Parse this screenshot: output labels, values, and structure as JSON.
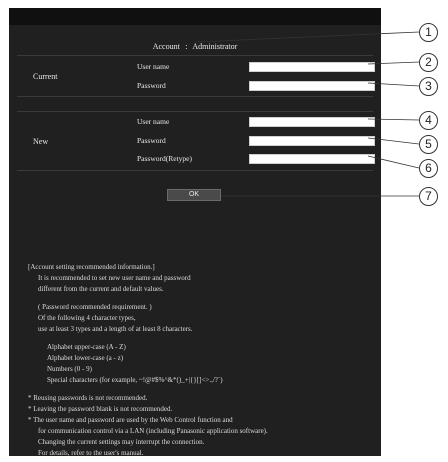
{
  "account": {
    "label": "Account",
    "separator": ":",
    "value": "Administrator"
  },
  "current": {
    "group_label": "Current",
    "user_name_label": "User name",
    "password_label": "Password",
    "user_name_value": "",
    "password_value": ""
  },
  "new": {
    "group_label": "New",
    "user_name_label": "User name",
    "password_label": "Password",
    "retype_label": "Password(Retype)",
    "user_name_value": "",
    "password_value": "",
    "retype_value": ""
  },
  "ok_label": "OK",
  "info": {
    "l1": "[Account setting recommended information.]",
    "l2": "It is recommended to set new user name and password",
    "l3": "different from the current and default values.",
    "l4": "( Password recommended requirement. )",
    "l5": "Of the following 4 character types,",
    "l6": "use at least 3 types and a length of at least 8 characters.",
    "l7": "Alphabet upper-case (A - Z)",
    "l8": "Alphabet lower-case (a - z)",
    "l9": "Numbers (0 - 9)",
    "l10": "Special characters (for example, ~!@#$%^&*()_+|{}[]<>.,/?`)",
    "l11": "* Reusing passwords is not recommended.",
    "l12": "* Leaving the password blank is not recommended.",
    "l13": "* The user name and password are used by the Web Control function and",
    "l14": "for communication control via a LAN (including Panasonic application software).",
    "l15": "Changing the current settings may interrupt the connection.",
    "l16": "For details, refer to the user's manual."
  },
  "callouts": [
    "1",
    "2",
    "3",
    "4",
    "5",
    "6",
    "7"
  ]
}
